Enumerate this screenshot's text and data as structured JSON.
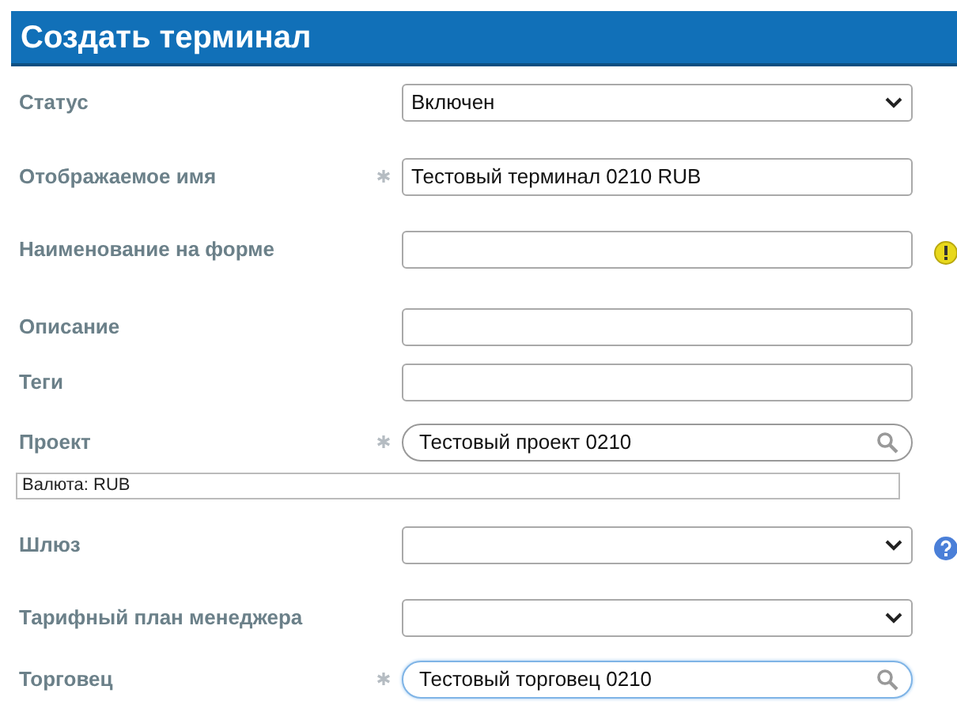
{
  "header": {
    "title": "Создать терминал"
  },
  "fields": [
    {
      "kind": "select",
      "label": "Статус",
      "required": false,
      "value": "Включен"
    },
    {
      "kind": "text",
      "label": "Отображаемое имя",
      "required": true,
      "value": "Тестовый терминал 0210 RUB"
    },
    {
      "kind": "text",
      "label": "Наименование на форме",
      "required": false,
      "warning": true
    },
    {
      "kind": "text",
      "label": "Описание",
      "required": false
    },
    {
      "kind": "text",
      "label": "Теги",
      "required": false
    },
    {
      "kind": "search",
      "label": "Проект",
      "required": true,
      "value": "Тестовый проект 0210",
      "focused": false
    },
    {
      "kind": "note",
      "value": "Валюта: RUB"
    },
    {
      "kind": "select",
      "label": "Шлюз",
      "required": false,
      "help": true
    },
    {
      "kind": "select",
      "label": "Тарифный план менеджера",
      "required": false
    },
    {
      "kind": "search",
      "label": "Торговец",
      "required": true,
      "value": "Тестовый торговец 0210",
      "focused": true
    }
  ]
}
